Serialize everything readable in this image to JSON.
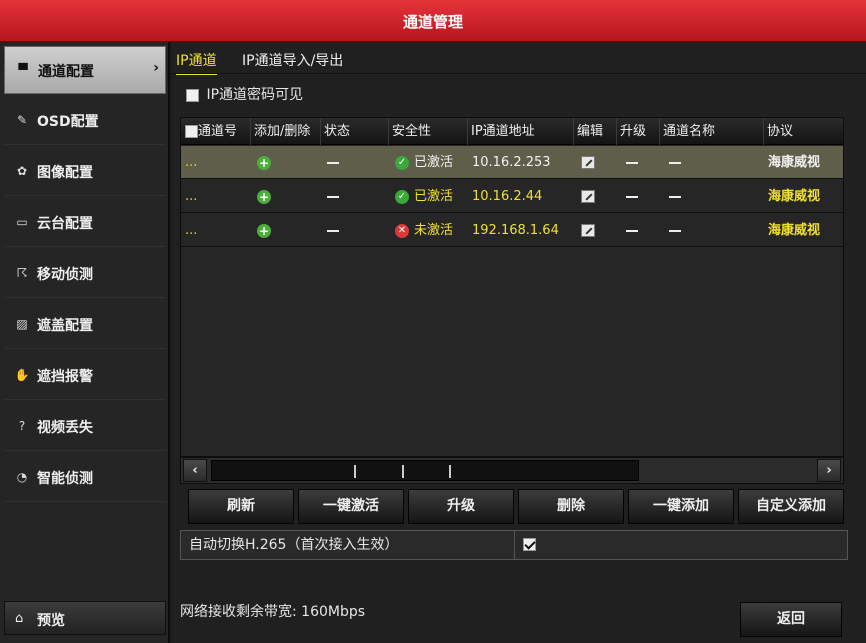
{
  "window": {
    "title": "通道管理"
  },
  "sidebar": {
    "items": [
      {
        "label": "通道配置",
        "icon": "camera-icon"
      },
      {
        "label": "OSD配置",
        "icon": "pen-icon"
      },
      {
        "label": "图像配置",
        "icon": "palette-icon"
      },
      {
        "label": "云台配置",
        "icon": "ptz-icon"
      },
      {
        "label": "移动侦测",
        "icon": "running-man-icon"
      },
      {
        "label": "遮盖配置",
        "icon": "mask-icon"
      },
      {
        "label": "遮挡报警",
        "icon": "hand-icon"
      },
      {
        "label": "视频丢失",
        "icon": "question-icon"
      },
      {
        "label": "智能侦测",
        "icon": "smart-icon"
      }
    ],
    "preview_label": "预览"
  },
  "tabs": [
    {
      "label": "IP通道"
    },
    {
      "label": "IP通道导入/导出"
    }
  ],
  "password_visible_label": "IP通道密码可见",
  "table": {
    "columns": [
      "通道号",
      "添加/删除",
      "状态",
      "安全性",
      "IP通道地址",
      "编辑",
      "升级",
      "通道名称",
      "协议"
    ],
    "rows": [
      {
        "channel": "...",
        "security": "已激活",
        "security_state": "ok",
        "ip": "10.16.2.253",
        "protocol": "海康威视"
      },
      {
        "channel": "...",
        "security": "已激活",
        "security_state": "ok",
        "ip": "10.16.2.44",
        "protocol": "海康威视"
      },
      {
        "channel": "...",
        "security": "未激活",
        "security_state": "bad",
        "ip": "192.168.1.64",
        "protocol": "海康威视"
      }
    ]
  },
  "buttons": {
    "refresh": "刷新",
    "one_click_activate": "一键激活",
    "upgrade": "升级",
    "delete": "删除",
    "one_click_add": "一键添加",
    "custom_add": "自定义添加",
    "back": "返回"
  },
  "option": {
    "label": "自动切换H.265（首次接入生效）",
    "checked": true
  },
  "bandwidth_text": "网络接收剩余带宽: 160Mbps",
  "colors": {
    "title_red": "#d1262c",
    "highlight_yellow": "#f0e030"
  }
}
